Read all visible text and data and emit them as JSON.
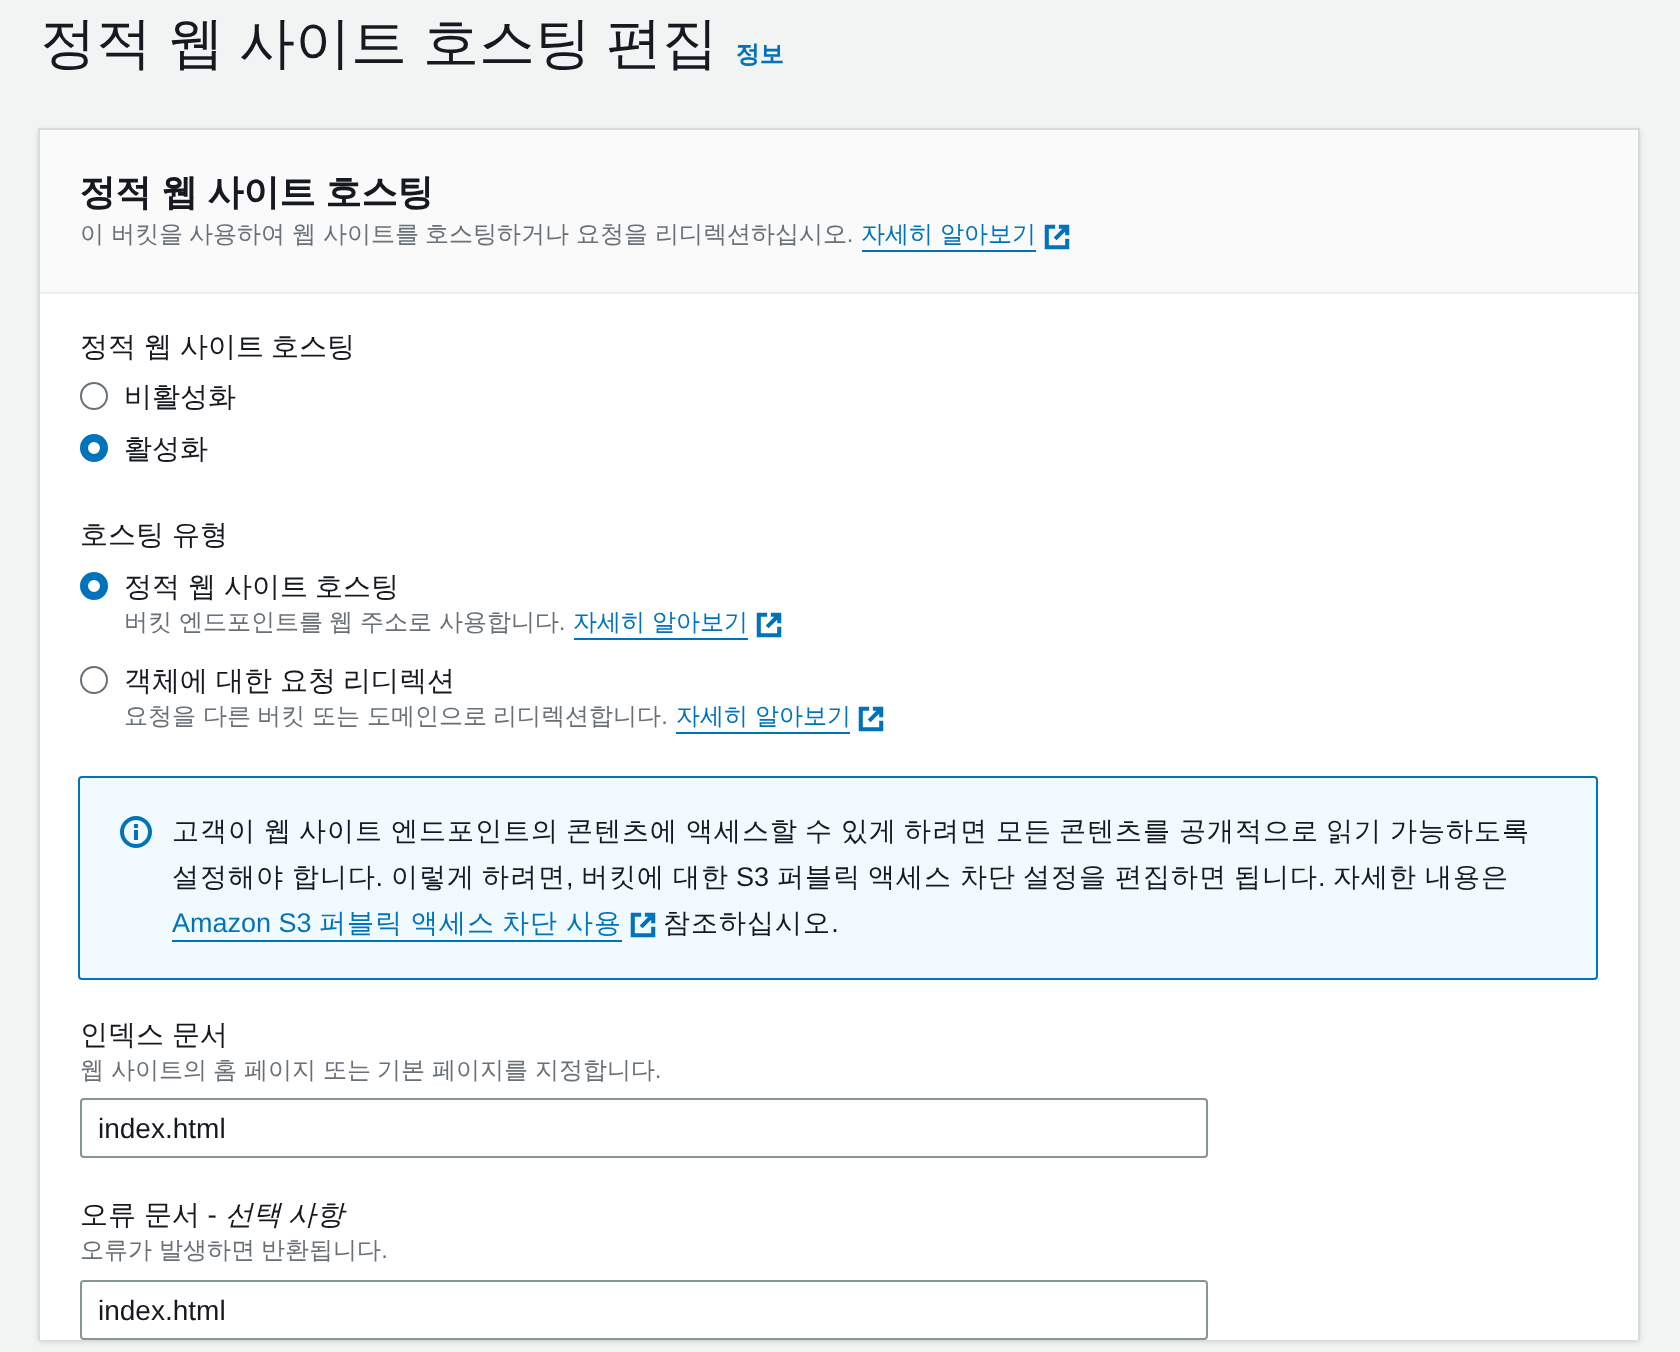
{
  "page": {
    "title": "정적 웹 사이트 호스팅 편집",
    "info_link": "정보"
  },
  "panel": {
    "title": "정적 웹 사이트 호스팅",
    "description": "이 버킷을 사용하여 웹 사이트를 호스팅하거나 요청을 리디렉션하십시오.",
    "learn_more": "자세히 알아보기"
  },
  "hosting": {
    "label": "정적 웹 사이트 호스팅",
    "options": [
      {
        "label": "비활성화",
        "selected": false
      },
      {
        "label": "활성화",
        "selected": true
      }
    ]
  },
  "hosting_type": {
    "label": "호스팅 유형",
    "options": [
      {
        "label": "정적 웹 사이트 호스팅",
        "description": "버킷 엔드포인트를 웹 주소로 사용합니다.",
        "learn_more": "자세히 알아보기",
        "selected": true
      },
      {
        "label": "객체에 대한 요청 리디렉션",
        "description": "요청을 다른 버킷 또는 도메인으로 리디렉션합니다.",
        "learn_more": "자세히 알아보기",
        "selected": false
      }
    ]
  },
  "info_alert": {
    "text": "고객이 웹 사이트 엔드포인트의 콘텐츠에 액세스할 수 있게 하려면 모든 콘텐츠를 공개적으로 읽기 가능하도록 설정해야 합니다. 이렇게 하려면, 버킷에 대한 S3 퍼블릭 액세스 차단 설정을 편집하면 됩니다. 자세한 내용은",
    "link": "Amazon S3 퍼블릭 액세스 차단 사용",
    "text_after": "참조하십시오."
  },
  "index_document": {
    "label": "인덱스 문서",
    "description": "웹 사이트의 홈 페이지 또는 기본 페이지를 지정합니다.",
    "value": "index.html"
  },
  "error_document": {
    "label": "오류 문서 - *선택 사항*",
    "description": "오류가 발생하면 반환됩니다.",
    "value": "index.html"
  }
}
